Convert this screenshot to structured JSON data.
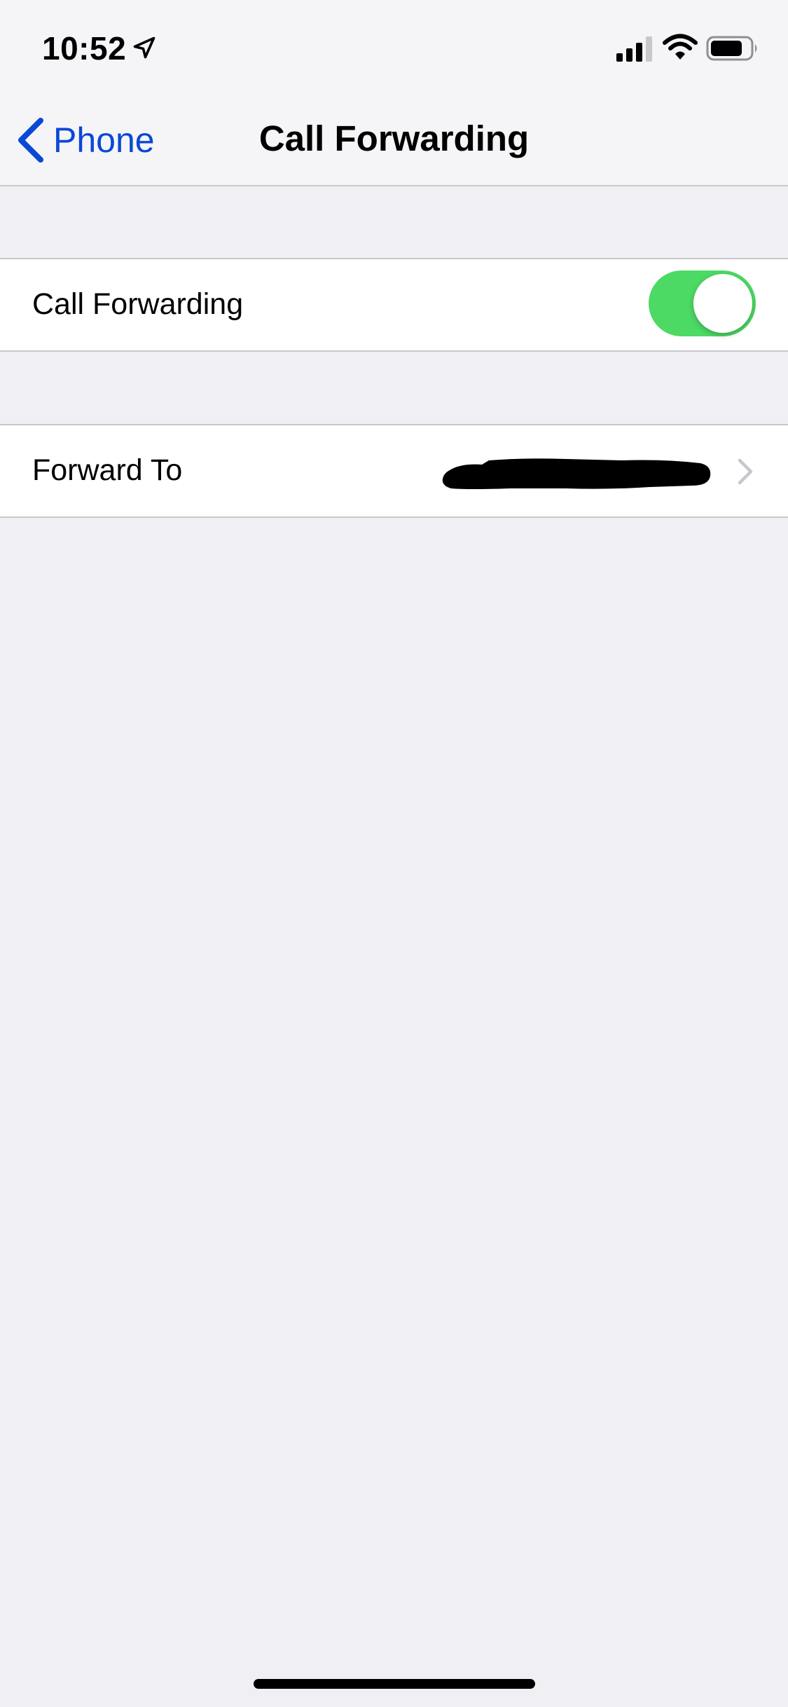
{
  "status_bar": {
    "time": "10:52",
    "icons": [
      "location-arrow-icon",
      "signal-bars-icon",
      "wifi-icon",
      "battery-icon"
    ]
  },
  "nav": {
    "back_label": "Phone",
    "title": "Call Forwarding"
  },
  "call_forwarding_cell": {
    "label": "Call Forwarding",
    "toggle_on": true
  },
  "forward_to_cell": {
    "label": "Forward To",
    "value_redacted": true
  },
  "colors": {
    "accent": "#0a48d6",
    "toggle_on": "#4cd964",
    "background": "#efeff4",
    "separator": "#c8c7cc"
  }
}
